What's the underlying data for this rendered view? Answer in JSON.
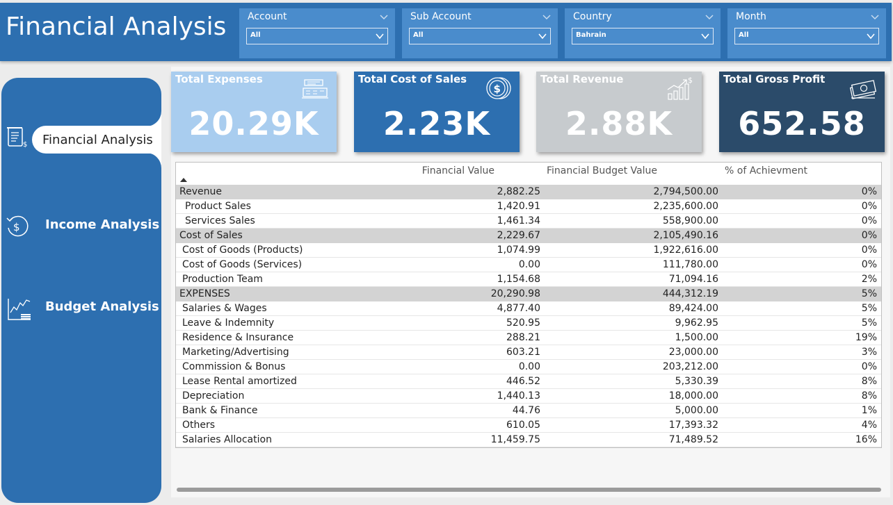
{
  "app": {
    "title": "Financial Analysis"
  },
  "filters": [
    {
      "label": "Account",
      "value": "All"
    },
    {
      "label": "Sub Account",
      "value": "All"
    },
    {
      "label": "Country",
      "value": "Bahrain"
    },
    {
      "label": "Month",
      "value": "All"
    }
  ],
  "nav": {
    "items": [
      {
        "label": "Financial Analysis",
        "icon": "document-dollar-icon",
        "active": true
      },
      {
        "label": "Income Analysis",
        "icon": "dollar-cycle-icon",
        "active": false
      },
      {
        "label": "Budget Analysis",
        "icon": "line-chart-icon",
        "active": false
      }
    ]
  },
  "kpis": [
    {
      "title": "Total Expenses",
      "value": "20.29K",
      "icon": "cash-register-icon",
      "color": "#a9cdef"
    },
    {
      "title": "Total Cost of Sales",
      "value": "2.23K",
      "icon": "coins-icon",
      "color": "#2d6fb0"
    },
    {
      "title": "Total Revenue",
      "value": "2.88K",
      "icon": "growth-chart-icon",
      "color": "#c7cbce"
    },
    {
      "title": "Total Gross Profit",
      "value": "652.58",
      "icon": "money-stack-icon",
      "color": "#2b4b6a"
    }
  ],
  "table": {
    "columns": [
      "Financial Value",
      "Financial Budget Value",
      "% of Achievment"
    ],
    "rows": [
      {
        "name": "Revenue",
        "group": true,
        "indent": 0,
        "value": "2,882.25",
        "budget": "2,794,500.00",
        "pct": "0%"
      },
      {
        "name": "Product Sales",
        "group": false,
        "indent": 2,
        "value": "1,420.91",
        "budget": "2,235,600.00",
        "pct": "0%"
      },
      {
        "name": "Services Sales",
        "group": false,
        "indent": 2,
        "value": "1,461.34",
        "budget": "558,900.00",
        "pct": "0%"
      },
      {
        "name": "Cost of Sales",
        "group": true,
        "indent": 0,
        "value": "2,229.67",
        "budget": "2,105,490.16",
        "pct": "0%"
      },
      {
        "name": "Cost of Goods (Products)",
        "group": false,
        "indent": 1,
        "value": "1,074.99",
        "budget": "1,922,616.00",
        "pct": "0%"
      },
      {
        "name": "Cost of Goods (Services)",
        "group": false,
        "indent": 1,
        "value": "0.00",
        "budget": "111,780.00",
        "pct": "0%"
      },
      {
        "name": "Production Team",
        "group": false,
        "indent": 1,
        "value": "1,154.68",
        "budget": "71,094.16",
        "pct": "2%"
      },
      {
        "name": "EXPENSES",
        "group": true,
        "indent": 0,
        "value": "20,290.98",
        "budget": "444,312.19",
        "pct": "5%"
      },
      {
        "name": "Salaries & Wages",
        "group": false,
        "indent": 1,
        "value": "4,877.40",
        "budget": "89,424.00",
        "pct": "5%"
      },
      {
        "name": "Leave & Indemnity",
        "group": false,
        "indent": 1,
        "value": "520.95",
        "budget": "9,962.95",
        "pct": "5%"
      },
      {
        "name": "Residence & Insurance",
        "group": false,
        "indent": 1,
        "value": "288.21",
        "budget": "1,500.00",
        "pct": "19%"
      },
      {
        "name": "Marketing/Advertising",
        "group": false,
        "indent": 1,
        "value": "603.21",
        "budget": "23,000.00",
        "pct": "3%"
      },
      {
        "name": "Commission & Bonus",
        "group": false,
        "indent": 1,
        "value": "0.00",
        "budget": "203,212.00",
        "pct": "0%"
      },
      {
        "name": "Lease Rental amortized",
        "group": false,
        "indent": 1,
        "value": "446.52",
        "budget": "5,330.39",
        "pct": "8%"
      },
      {
        "name": "Depreciation",
        "group": false,
        "indent": 1,
        "value": "1,440.13",
        "budget": "18,000.00",
        "pct": "8%"
      },
      {
        "name": "Bank & Finance",
        "group": false,
        "indent": 1,
        "value": "44.76",
        "budget": "5,000.00",
        "pct": "1%"
      },
      {
        "name": "Others",
        "group": false,
        "indent": 1,
        "value": "610.05",
        "budget": "17,393.32",
        "pct": "4%"
      },
      {
        "name": "Salaries Allocation",
        "group": false,
        "indent": 1,
        "value": "11,459.75",
        "budget": "71,489.52",
        "pct": "16%"
      }
    ]
  }
}
